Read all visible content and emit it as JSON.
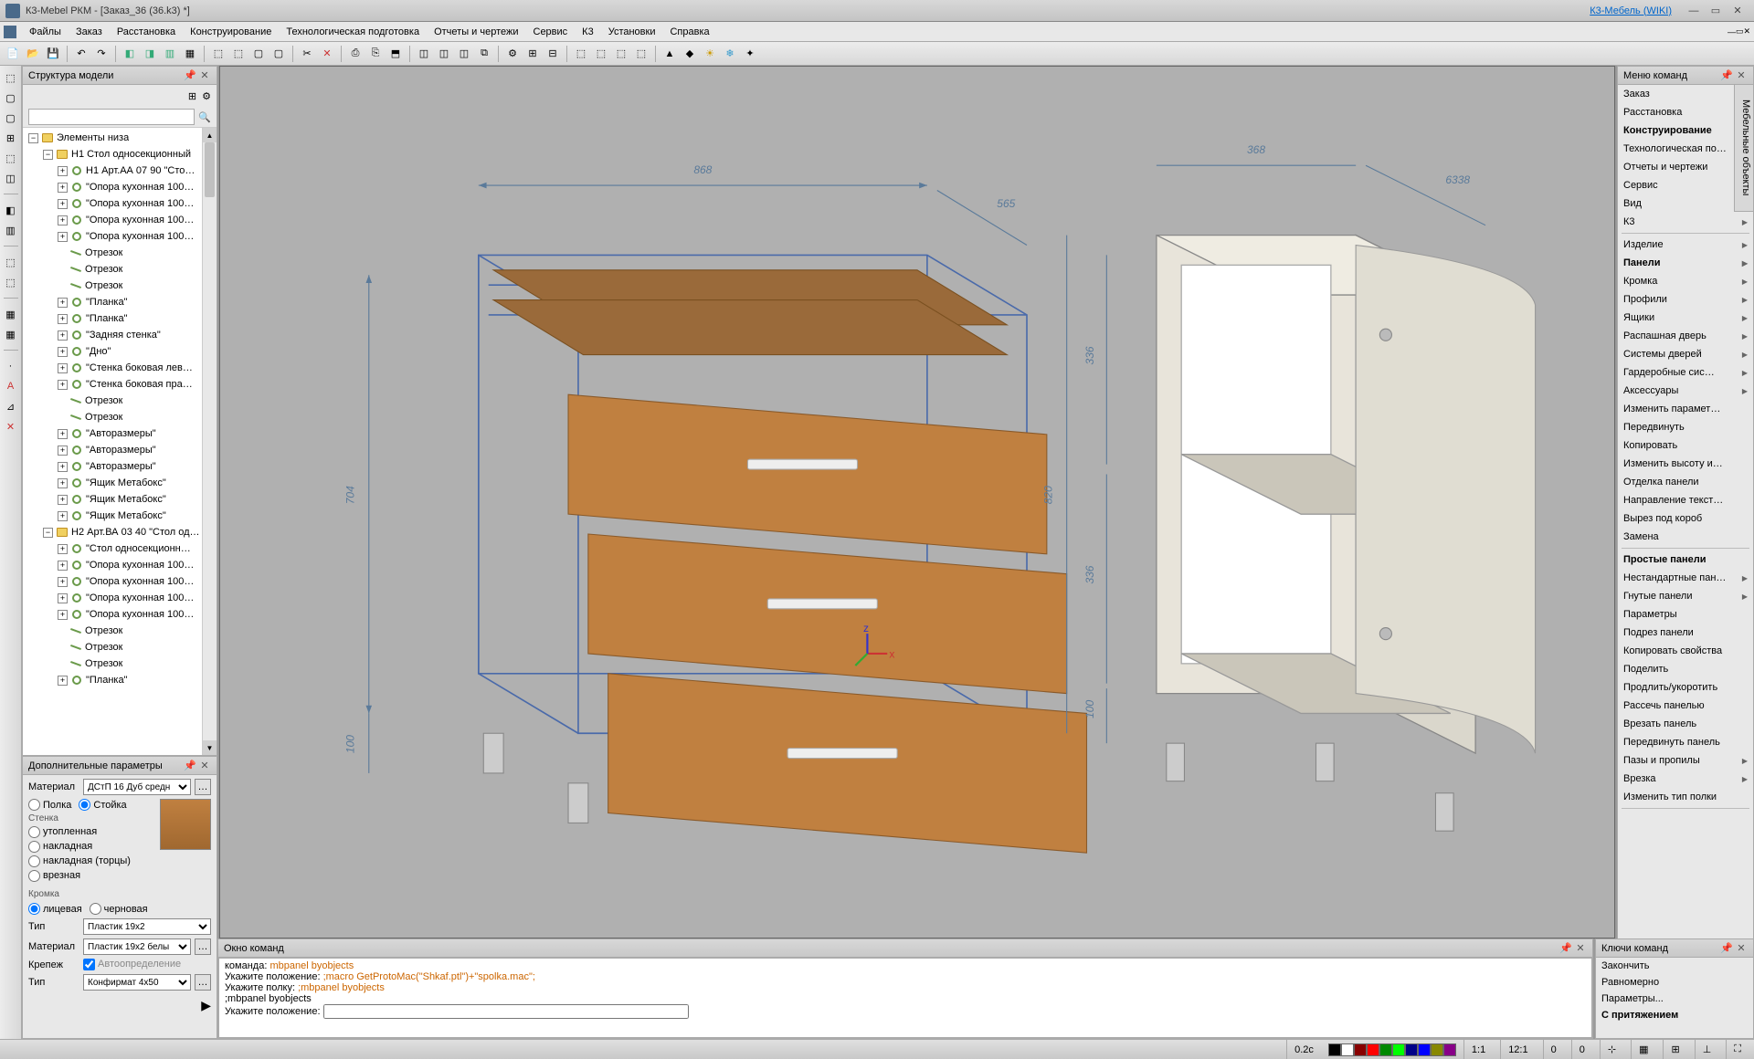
{
  "title": "К3-Mebel РКМ - [Заказ_36 (36.k3) *]",
  "wiki_link": "К3-Мебель (WIKI)",
  "menu": [
    "Файлы",
    "Заказ",
    "Расстановка",
    "Конструирование",
    "Технологическая подготовка",
    "Отчеты и чертежи",
    "Сервис",
    "К3",
    "Установки",
    "Справка"
  ],
  "tree_panel_title": "Структура модели",
  "tree": [
    {
      "d": 0,
      "ex": "−",
      "ic": "folder",
      "t": "Элементы низа"
    },
    {
      "d": 1,
      "ex": "−",
      "ic": "folder",
      "t": "Н1 Стол односекционный"
    },
    {
      "d": 2,
      "ex": "+",
      "ic": "grn",
      "t": "Н1 Арт.АА 07 90 \"Сто…"
    },
    {
      "d": 2,
      "ex": "+",
      "ic": "grn",
      "t": "\"Опора кухонная 100…"
    },
    {
      "d": 2,
      "ex": "+",
      "ic": "grn",
      "t": "\"Опора кухонная 100…"
    },
    {
      "d": 2,
      "ex": "+",
      "ic": "grn",
      "t": "\"Опора кухонная 100…"
    },
    {
      "d": 2,
      "ex": "+",
      "ic": "grn",
      "t": "\"Опора кухонная 100…"
    },
    {
      "d": 2,
      "ex": "",
      "ic": "seg",
      "t": "Отрезок"
    },
    {
      "d": 2,
      "ex": "",
      "ic": "seg",
      "t": "Отрезок"
    },
    {
      "d": 2,
      "ex": "",
      "ic": "seg",
      "t": "Отрезок"
    },
    {
      "d": 2,
      "ex": "+",
      "ic": "grn",
      "t": "\"Планка\""
    },
    {
      "d": 2,
      "ex": "+",
      "ic": "grn",
      "t": "\"Планка\""
    },
    {
      "d": 2,
      "ex": "+",
      "ic": "grn",
      "t": "\"Задняя стенка\""
    },
    {
      "d": 2,
      "ex": "+",
      "ic": "grn",
      "t": "\"Дно\""
    },
    {
      "d": 2,
      "ex": "+",
      "ic": "grn",
      "t": "\"Стенка боковая лев…"
    },
    {
      "d": 2,
      "ex": "+",
      "ic": "grn",
      "t": "\"Стенка боковая пра…"
    },
    {
      "d": 2,
      "ex": "",
      "ic": "seg",
      "t": "Отрезок"
    },
    {
      "d": 2,
      "ex": "",
      "ic": "seg",
      "t": "Отрезок"
    },
    {
      "d": 2,
      "ex": "+",
      "ic": "grn",
      "t": "\"Авторазмеры\""
    },
    {
      "d": 2,
      "ex": "+",
      "ic": "grn",
      "t": "\"Авторазмеры\""
    },
    {
      "d": 2,
      "ex": "+",
      "ic": "grn",
      "t": "\"Авторазмеры\""
    },
    {
      "d": 2,
      "ex": "+",
      "ic": "grn",
      "t": "\"Ящик Метабокс\""
    },
    {
      "d": 2,
      "ex": "+",
      "ic": "grn",
      "t": "\"Ящик Метабокс\""
    },
    {
      "d": 2,
      "ex": "+",
      "ic": "grn",
      "t": "\"Ящик Метабокс\""
    },
    {
      "d": 1,
      "ex": "−",
      "ic": "folder",
      "t": "Н2 Арт.ВА 03 40 \"Стол од…"
    },
    {
      "d": 2,
      "ex": "+",
      "ic": "grn",
      "t": "\"Стол односекционн…"
    },
    {
      "d": 2,
      "ex": "+",
      "ic": "grn",
      "t": "\"Опора кухонная 100…"
    },
    {
      "d": 2,
      "ex": "+",
      "ic": "grn",
      "t": "\"Опора кухонная 100…"
    },
    {
      "d": 2,
      "ex": "+",
      "ic": "grn",
      "t": "\"Опора кухонная 100…"
    },
    {
      "d": 2,
      "ex": "+",
      "ic": "grn",
      "t": "\"Опора кухонная 100…"
    },
    {
      "d": 2,
      "ex": "",
      "ic": "seg",
      "t": "Отрезок"
    },
    {
      "d": 2,
      "ex": "",
      "ic": "seg",
      "t": "Отрезок"
    },
    {
      "d": 2,
      "ex": "",
      "ic": "seg",
      "t": "Отрезок"
    },
    {
      "d": 2,
      "ex": "+",
      "ic": "grn",
      "t": "\"Планка\""
    }
  ],
  "params_panel_title": "Дополнительные параметры",
  "params": {
    "material_label": "Материал",
    "material_value": "ДСтП 16 Дуб средн",
    "polka": "Полка",
    "stoika": "Стойка",
    "stenka": "Стенка",
    "utoplennaia": "утопленная",
    "nakladnaia": "накладная",
    "nakladnaia_tortsy": "накладная (торцы)",
    "vreznaia": "врезная",
    "kromka": "Кромка",
    "litsevaia": "лицевая",
    "chernovaia": "черновая",
    "tip": "Тип",
    "tip_value": "Пластик 19x2",
    "material2_value": "Пластик 19x2 белы",
    "krepezh": "Крепеж",
    "avtodef": "Автоопределение",
    "tip2": "Тип",
    "tip2_value": "Конфирмат 4х50"
  },
  "cmd_menu_title": "Меню команд",
  "cmd_section1": [
    {
      "t": "Заказ",
      "a": true
    },
    {
      "t": "Расстановка",
      "a": true
    },
    {
      "t": "Конструирование",
      "a": true,
      "b": true
    },
    {
      "t": "Технологическая по…",
      "a": true
    },
    {
      "t": "Отчеты и чертежи",
      "a": true
    },
    {
      "t": "Сервис",
      "a": true
    },
    {
      "t": "Вид",
      "a": true
    },
    {
      "t": "К3",
      "a": true
    }
  ],
  "cmd_section2": [
    {
      "t": "Изделие",
      "a": true
    },
    {
      "t": "Панели",
      "a": true,
      "b": true
    },
    {
      "t": "Кромка",
      "a": true
    },
    {
      "t": "Профили",
      "a": true
    },
    {
      "t": "Ящики",
      "a": true
    },
    {
      "t": "Распашная дверь",
      "a": true
    },
    {
      "t": "Системы дверей",
      "a": true
    },
    {
      "t": "Гардеробные сис…",
      "a": true
    },
    {
      "t": "Аксессуары",
      "a": true
    },
    {
      "t": "Изменить парамет…"
    },
    {
      "t": "Передвинуть"
    },
    {
      "t": "Копировать"
    },
    {
      "t": "Изменить высоту и…"
    },
    {
      "t": "Отделка панели"
    },
    {
      "t": "Направление текст…"
    },
    {
      "t": "Вырез под короб"
    },
    {
      "t": "Замена"
    }
  ],
  "cmd_section3": [
    {
      "t": "Простые панели",
      "b": true
    },
    {
      "t": "Нестандартные пан…",
      "a": true
    },
    {
      "t": "Гнутые панели",
      "a": true
    },
    {
      "t": "Параметры"
    },
    {
      "t": "Подрез панели"
    },
    {
      "t": "Копировать свойства"
    },
    {
      "t": "Поделить"
    },
    {
      "t": "Продлить/укоротить"
    },
    {
      "t": "Рассечь панелью"
    },
    {
      "t": "Врезать панель"
    },
    {
      "t": "Передвинуть панель"
    },
    {
      "t": "Пазы и пропилы",
      "a": true
    },
    {
      "t": "Врезка",
      "a": true
    },
    {
      "t": "Изменить тип полки"
    }
  ],
  "right_tab": "Мебельные объекты",
  "cmd_window_title": "Окно команд",
  "cmd_lines": [
    {
      "pre": "команда: ",
      "cmd": "mbpanel byobjects"
    },
    {
      "pre": "Укажите положение: ",
      "cmd": ";macro GetProtoMac(\"Shkaf.ptl\")+\"spolka.mac\";"
    },
    {
      "pre": "Укажите полку: ",
      "cmd": ";mbpanel byobjects"
    },
    {
      "pre": ";mbpanel byobjects",
      "cmd": ""
    },
    {
      "pre": "Укажите положение: ",
      "cmd": "",
      "input": true
    }
  ],
  "keys_title": "Ключи команд",
  "keys": [
    "Закончить",
    "Равномерно",
    "Параметры...",
    "С притяжением"
  ],
  "status": {
    "time": "0.2c",
    "scale1": "1:1",
    "scale2": "12:1",
    "zero": "0",
    "zero2": "0"
  },
  "dims": {
    "w868": "868",
    "d565": "565",
    "h704": "704",
    "h100": "100",
    "w368": "368",
    "d6338": "6338",
    "h820": "820",
    "h336a": "336",
    "h336b": "336",
    "h100b": "100"
  }
}
